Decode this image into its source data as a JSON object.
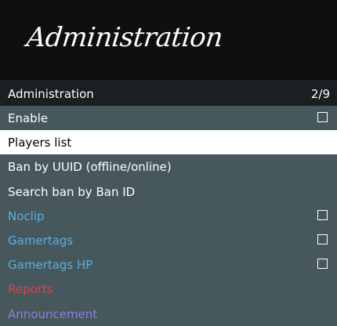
{
  "banner": {
    "title": "Administration"
  },
  "subheader": {
    "title": "Administration",
    "counter": "2/9"
  },
  "menu": {
    "items": [
      {
        "label": "Enable",
        "checkbox": true,
        "checked": false,
        "color": "#ffffff"
      },
      {
        "label": "Players list",
        "selected": true
      },
      {
        "label": "Ban by UUID (offline/online)"
      },
      {
        "label": "Search ban by Ban ID"
      },
      {
        "label": "Noclip",
        "checkbox": true,
        "checked": false,
        "color": "#5aaee0"
      },
      {
        "label": "Gamertags",
        "checkbox": true,
        "checked": false,
        "color": "#5aaee0"
      },
      {
        "label": "Gamertags HP",
        "checkbox": true,
        "checked": false,
        "color": "#5aaee0"
      },
      {
        "label": "Reports",
        "color": "#d9434a"
      },
      {
        "label": "Announcement",
        "color": "#8f7fe0"
      }
    ]
  }
}
